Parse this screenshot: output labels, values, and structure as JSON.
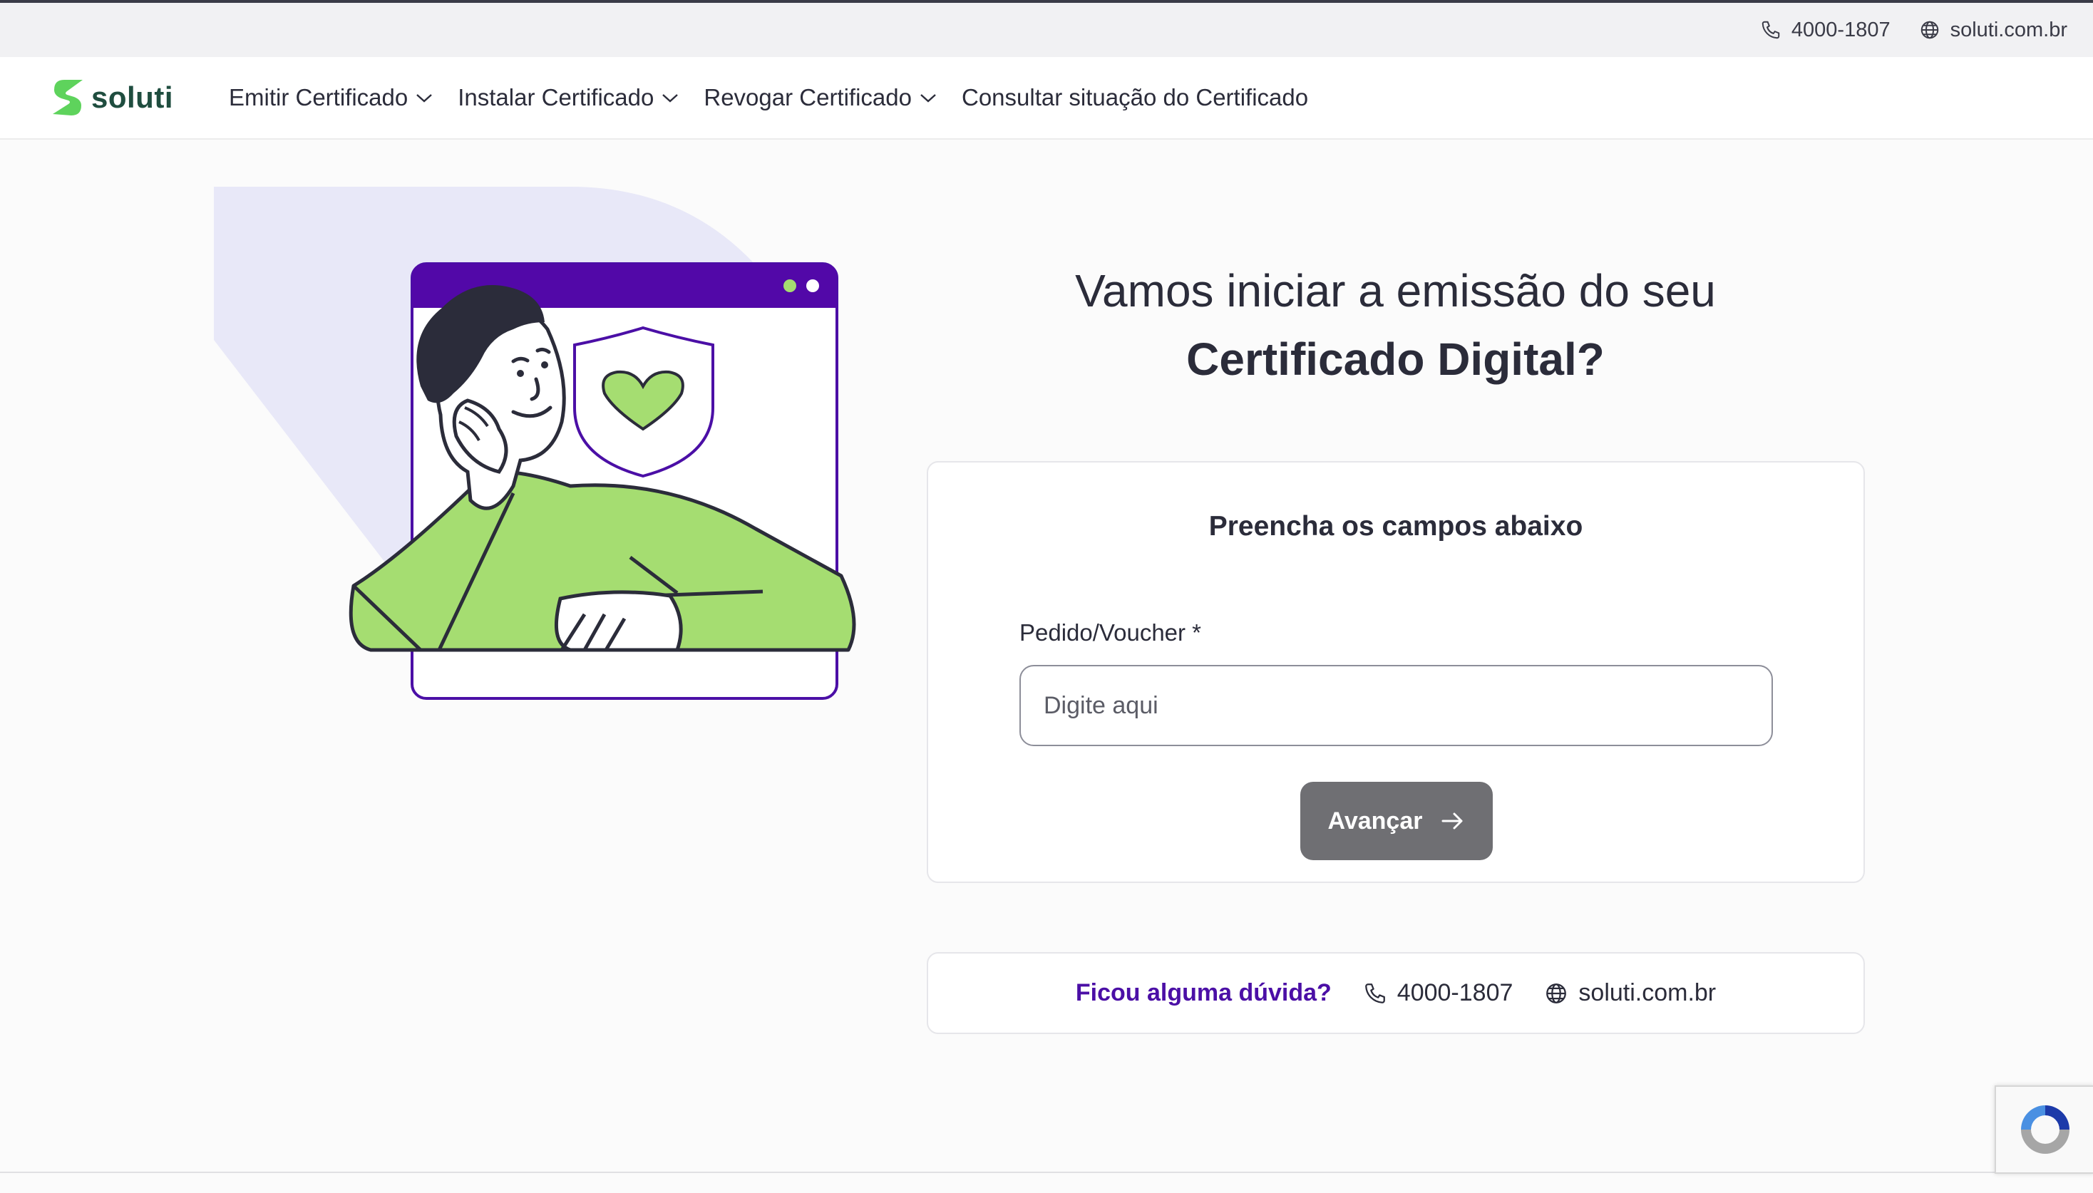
{
  "topbar": {
    "phone": "4000-1807",
    "website": "soluti.com.br"
  },
  "nav": {
    "logo_text": "soluti",
    "items": [
      {
        "label": "Emitir Certificado",
        "has_dropdown": true
      },
      {
        "label": "Instalar Certificado",
        "has_dropdown": true
      },
      {
        "label": "Revogar Certificado",
        "has_dropdown": true
      },
      {
        "label": "Consultar situação do Certificado",
        "has_dropdown": false
      }
    ]
  },
  "main": {
    "heading_line1": "Vamos iniciar a emissão do seu",
    "heading_line2": "Certificado Digital?"
  },
  "form": {
    "title": "Preencha os campos abaixo",
    "field_label": "Pedido/Voucher *",
    "field_value": "",
    "field_placeholder": "Digite aqui",
    "submit_label": "Avançar"
  },
  "help": {
    "question": "Ficou alguma dúvida?",
    "phone": "4000-1807",
    "website": "soluti.com.br"
  },
  "colors": {
    "brand_green": "#5ed35c",
    "brand_dark_green": "#1f4d3f",
    "accent_purple": "#4b0fa6",
    "button_gray": "#6f6f73",
    "illustration_green": "#a5dd71",
    "illustration_lavender": "#e8e8f8"
  }
}
